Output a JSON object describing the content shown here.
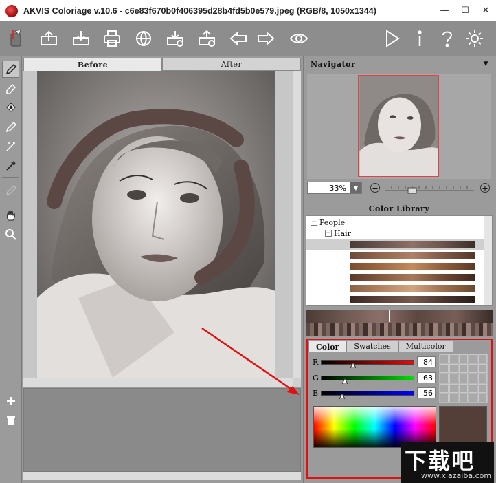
{
  "window": {
    "title": "AKVIS Coloriage v.10.6 - c6e83f670b0f406395d28b4fd5b0e579.jpeg (RGB/8, 1050x1344)",
    "min": "—",
    "max": "☐",
    "close": "✕"
  },
  "toolbar": {
    "items": [
      "open-icon",
      "save-icon",
      "print-icon",
      "share-icon",
      "import-strokes-icon",
      "export-strokes-icon",
      "undo-icon",
      "redo-icon",
      "preview-icon",
      "run-icon",
      "info-icon",
      "help-icon",
      "settings-icon"
    ]
  },
  "tools": [
    "pencil-icon",
    "eraser-icon",
    "bucket-icon",
    "magic-pencil-icon",
    "magic-wand-icon",
    "eyedropper-icon",
    "disabled-brush-icon",
    "hand-icon",
    "zoom-icon",
    "add-icon",
    "trash-icon"
  ],
  "canvas": {
    "tab_before": "Before",
    "tab_after": "After"
  },
  "navigator": {
    "title": "Navigator",
    "zoom": "33%"
  },
  "library": {
    "title": "Color Library",
    "root": "People",
    "child": "Hair"
  },
  "color_panel": {
    "tabs": [
      "Color",
      "Swatches",
      "Multicolor"
    ],
    "r_label": "R",
    "g_label": "G",
    "b_label": "B",
    "r": 84,
    "g": 63,
    "b": 56,
    "current_color": "#543f38"
  },
  "watermark": {
    "big": "下载吧",
    "small": "www.xiazaiba.com"
  },
  "colors": {
    "accent_red": "#e01010",
    "stroke_brown": "#5b4743"
  }
}
